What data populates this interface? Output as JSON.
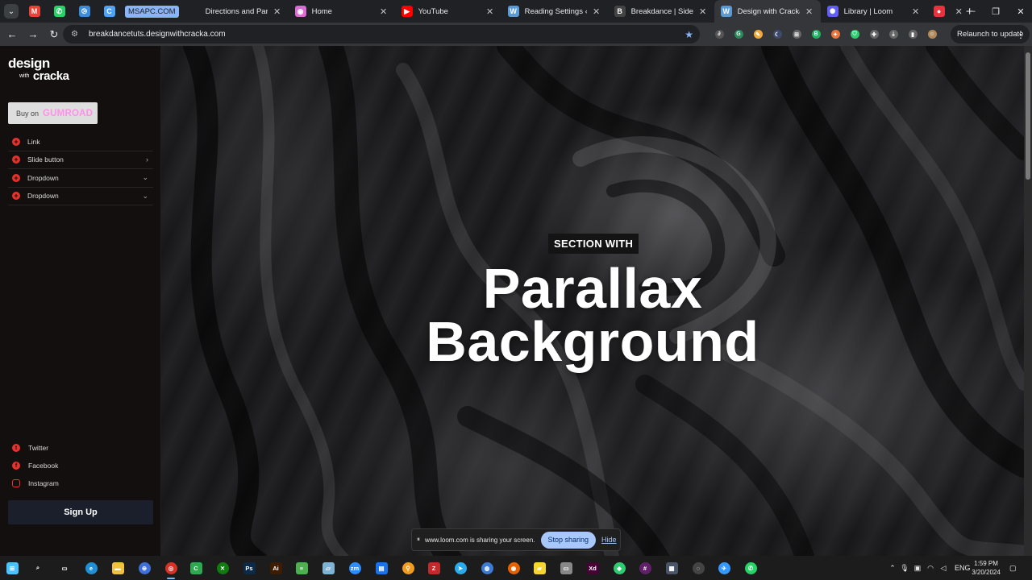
{
  "browser": {
    "pinned_tabs": [
      {
        "icon": "gmail-icon",
        "color": "#ea4335",
        "glyph": "M"
      },
      {
        "icon": "whatsapp-icon",
        "color": "#25d366",
        "glyph": "✆"
      },
      {
        "icon": "vscode-icon",
        "color": "#3c8cdc",
        "glyph": "⧁"
      },
      {
        "icon": "refresh-app-icon",
        "color": "#4fa3f7",
        "glyph": "C"
      }
    ],
    "tab_group_label": "MSAPC.COM",
    "tabs": [
      {
        "label": "Directions and Parking",
        "icon": "generic-page-icon",
        "color": "#202124",
        "glyph": ""
      },
      {
        "label": "Home",
        "icon": "home-site-icon",
        "color": "#d96dd4",
        "glyph": "◉"
      },
      {
        "label": "YouTube",
        "icon": "youtube-icon",
        "color": "#ff0000",
        "glyph": "▶"
      },
      {
        "label": "Reading Settings ‹ Desi",
        "icon": "wordpress-icon",
        "color": "#5b9bd5",
        "glyph": "W"
      },
      {
        "label": "Breakdance | Sidebar N",
        "icon": "breakdance-icon",
        "color": "#444",
        "glyph": "B"
      },
      {
        "label": "Design with Cracka Tuto",
        "icon": "wordpress-icon",
        "color": "#5b9bd5",
        "glyph": "W",
        "active": true
      },
      {
        "label": "Library | Loom",
        "icon": "loom-icon",
        "color": "#625df5",
        "glyph": "✺"
      },
      {
        "label": "",
        "icon": "record-icon",
        "color": "#e8323e",
        "glyph": "●"
      }
    ],
    "url": "breakdancetuts.designwithcracka.com",
    "relaunch_label": "Relaunch to update",
    "extensions": [
      {
        "icon": "reader-ext-icon",
        "color": "#555",
        "glyph": "∂"
      },
      {
        "icon": "grammarly-ext-icon",
        "color": "#2a8a5c",
        "glyph": "G"
      },
      {
        "icon": "pencil-ext-icon",
        "color": "#f2a93b",
        "glyph": "✎"
      },
      {
        "icon": "dark-mode-ext-icon",
        "color": "#3e4a6b",
        "glyph": "☾"
      },
      {
        "icon": "screenshot-ext-icon",
        "color": "#666",
        "glyph": "⊞"
      },
      {
        "icon": "b-ext-icon",
        "color": "#27ae60",
        "glyph": "B"
      },
      {
        "icon": "fox-ext-icon",
        "color": "#e8763b",
        "glyph": "✦"
      },
      {
        "icon": "shield-ext-icon",
        "color": "#2ecc71",
        "glyph": "⛉"
      },
      {
        "icon": "puzzle-ext-icon",
        "color": "#666",
        "glyph": "✚"
      },
      {
        "icon": "download-icon",
        "color": "#666",
        "glyph": "⤓"
      },
      {
        "icon": "sidepanel-icon",
        "color": "#666",
        "glyph": "▮"
      },
      {
        "icon": "profile-avatar-icon",
        "color": "#b08a5a",
        "glyph": "☺"
      }
    ]
  },
  "sidebar": {
    "logo_line1": "design",
    "logo_with": "with",
    "logo_line2": "cracka",
    "buy_prefix": "Buy on",
    "buy_brand": "GUMROAD",
    "menu": [
      {
        "label": "Link",
        "chevron": ""
      },
      {
        "label": "Slide button",
        "chevron": "›"
      },
      {
        "label": "Dropdown",
        "chevron": "⌄"
      },
      {
        "label": "Dropdown",
        "chevron": "⌄"
      }
    ],
    "social": [
      {
        "label": "Twitter",
        "icon": "twitter-icon",
        "glyph": "t"
      },
      {
        "label": "Facebook",
        "icon": "facebook-icon",
        "glyph": "f"
      },
      {
        "label": "Instagram",
        "icon": "instagram-icon",
        "glyph": "◎"
      }
    ],
    "signup_label": "Sign Up",
    "accent_color": "#e8322e"
  },
  "hero": {
    "label": "SECTION WITH",
    "title_line1": "Parallax",
    "title_line2": "Background"
  },
  "share_bar": {
    "message": "www.loom.com is sharing your screen.",
    "stop_label": "Stop sharing",
    "hide_label": "Hide"
  },
  "taskbar": {
    "apps": [
      {
        "icon": "windows-start-icon",
        "color": "#4cc2ff",
        "glyph": "⊞",
        "shape": "sq"
      },
      {
        "icon": "search-icon",
        "color": "#1c1c1c",
        "glyph": "⌕",
        "shape": "sq"
      },
      {
        "icon": "task-view-icon",
        "color": "#1c1c1c",
        "glyph": "▭",
        "shape": "sq"
      },
      {
        "icon": "edge-icon",
        "color": "#1f8fd6",
        "glyph": "e",
        "shape": "c"
      },
      {
        "icon": "file-explorer-icon",
        "color": "#f0c040",
        "glyph": "▬",
        "shape": "sq"
      },
      {
        "icon": "globe-app-icon",
        "color": "#3f6fd8",
        "glyph": "⊕",
        "shape": "c"
      },
      {
        "icon": "chrome-icon",
        "color": "#d93025",
        "glyph": "◎",
        "shape": "c",
        "active": true
      },
      {
        "icon": "camtasia-icon",
        "color": "#2fa84f",
        "glyph": "C",
        "shape": "sq"
      },
      {
        "icon": "xbox-icon",
        "color": "#107c10",
        "glyph": "✕",
        "shape": "c"
      },
      {
        "icon": "photoshop-icon",
        "color": "#0b2a4a",
        "glyph": "Ps",
        "shape": "sq"
      },
      {
        "icon": "illustrator-icon",
        "color": "#3d1c00",
        "glyph": "Ai",
        "shape": "sq"
      },
      {
        "icon": "notepad-icon",
        "color": "#4caf50",
        "glyph": "≡",
        "shape": "sq"
      },
      {
        "icon": "board-app-icon",
        "color": "#7fb3d5",
        "glyph": "▱",
        "shape": "sq"
      },
      {
        "icon": "zoom-icon",
        "color": "#2d8cff",
        "glyph": "zm",
        "shape": "c"
      },
      {
        "icon": "sheets-app-icon",
        "color": "#1a73e8",
        "glyph": "▤",
        "shape": "sq"
      },
      {
        "icon": "search-tool-icon",
        "color": "#f29b1c",
        "glyph": "⚲",
        "shape": "c"
      },
      {
        "icon": "filezilla-icon",
        "color": "#bf2a2a",
        "glyph": "Z",
        "shape": "sq"
      },
      {
        "icon": "telegram-icon",
        "color": "#2aabee",
        "glyph": "➤",
        "shape": "c"
      },
      {
        "icon": "store-app-icon",
        "color": "#3a7bd5",
        "glyph": "◍",
        "shape": "c"
      },
      {
        "icon": "firefox-icon",
        "color": "#e66000",
        "glyph": "◉",
        "shape": "c"
      },
      {
        "icon": "sticky-notes-icon",
        "color": "#f7d531",
        "glyph": "▰",
        "shape": "sq"
      },
      {
        "icon": "display-app-icon",
        "color": "#888",
        "glyph": "▭",
        "shape": "sq"
      },
      {
        "icon": "xd-icon",
        "color": "#470137",
        "glyph": "Xd",
        "shape": "sq"
      },
      {
        "icon": "vpn-app-icon",
        "color": "#2ecc71",
        "glyph": "◆",
        "shape": "c"
      },
      {
        "icon": "slack-icon",
        "color": "#611f69",
        "glyph": "#",
        "shape": "c"
      },
      {
        "icon": "calculator-icon",
        "color": "#4a5568",
        "glyph": "▦",
        "shape": "sq"
      },
      {
        "icon": "screen-recorder-icon",
        "color": "#444",
        "glyph": "◌",
        "shape": "c"
      },
      {
        "icon": "messenger-icon",
        "color": "#3399ff",
        "glyph": "✈",
        "shape": "c"
      },
      {
        "icon": "whatsapp-taskbar-icon",
        "color": "#25d366",
        "glyph": "✆",
        "shape": "c"
      }
    ],
    "language": "ENG",
    "time": "1:59 PM",
    "date": "3/20/2024"
  }
}
